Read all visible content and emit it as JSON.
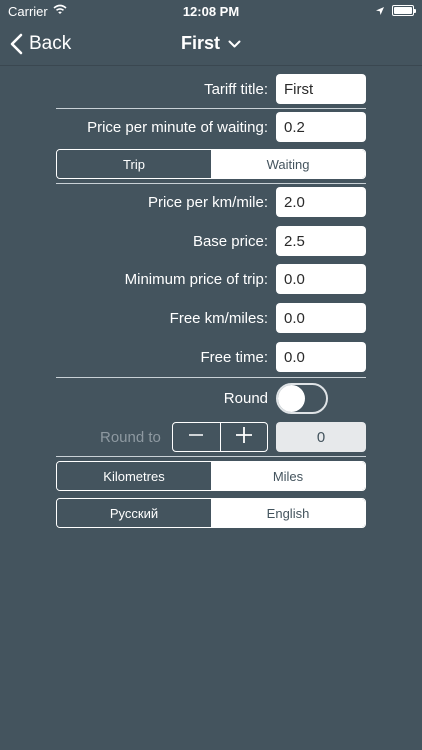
{
  "status_bar": {
    "carrier": "Carrier",
    "time": "12:08 PM"
  },
  "nav": {
    "back_label": "Back",
    "title": "First"
  },
  "tariff_title": {
    "label": "Tariff title:",
    "value": "First"
  },
  "price_per_minute_waiting": {
    "label": "Price per minute of waiting:",
    "value": "0.2"
  },
  "mode_tabs": {
    "trip": "Trip",
    "waiting": "Waiting",
    "selected": "trip"
  },
  "fields": {
    "price_per_km": {
      "label": "Price per km/mile:",
      "value": "2.0"
    },
    "base_price": {
      "label": "Base price:",
      "value": "2.5"
    },
    "min_price": {
      "label": "Minimum price of trip:",
      "value": "0.0"
    },
    "free_km": {
      "label": "Free km/miles:",
      "value": "0.0"
    },
    "free_time": {
      "label": "Free time:",
      "value": "0.0"
    }
  },
  "round": {
    "label": "Round",
    "on": false
  },
  "round_to": {
    "label": "Round to",
    "value": "0"
  },
  "units": {
    "kilometres": "Kilometres",
    "miles": "Miles",
    "selected": "kilometres"
  },
  "language": {
    "russian": "Русский",
    "english": "English",
    "selected": "russian"
  },
  "colors": {
    "background": "#44545e",
    "field": "#ffffff",
    "accent": "#ffffff"
  }
}
